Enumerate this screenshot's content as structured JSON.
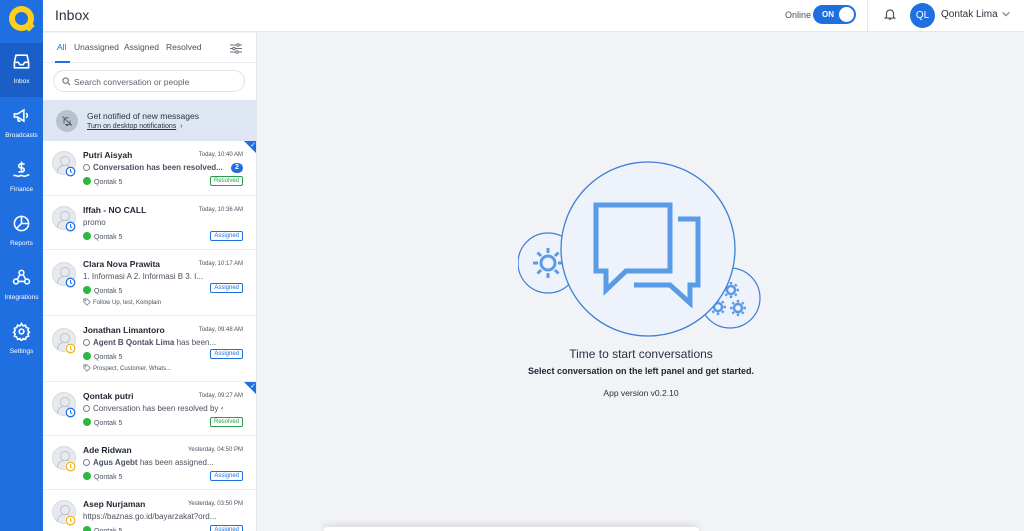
{
  "app": {
    "title": "Inbox"
  },
  "sidebar": {
    "items": [
      {
        "label": "Inbox",
        "icon": "inbox-icon",
        "active": true
      },
      {
        "label": "Broadcasts",
        "icon": "megaphone-icon"
      },
      {
        "label": "Finance",
        "icon": "dollar-icon"
      },
      {
        "label": "Reports",
        "icon": "pie-chart-icon"
      },
      {
        "label": "Integrations",
        "icon": "integrations-icon"
      },
      {
        "label": "Settings",
        "icon": "gear-icon"
      }
    ]
  },
  "topbar": {
    "status_label": "Online",
    "toggle_label": "ON",
    "user_initials": "QL",
    "user_name": "Qontak Lima"
  },
  "tabs": [
    "All",
    "Unassigned",
    "Assigned",
    "Resolved"
  ],
  "search": {
    "placeholder": "Search conversation or people"
  },
  "notification": {
    "title": "Get notified of new messages",
    "link": "Turn on desktop notifications"
  },
  "conversations": [
    {
      "name": "Putri Aisyah",
      "time": "Today, 10:40 AM",
      "preview": "Conversation has been resolved...",
      "preview_bold": true,
      "channel": "Qontak 5",
      "status": "Resolved",
      "unread": "2",
      "selected": true,
      "clock_color": "#1f6fe0"
    },
    {
      "name": "Iffah - NO CALL",
      "time": "Today, 10:36 AM",
      "preview": "promo",
      "channel": "Qontak 5",
      "status": "Assigned",
      "clock_color": "#1f6fe0"
    },
    {
      "name": "Clara Nova Prawita",
      "time": "Today, 10:17 AM",
      "preview": "1. Informasi A 2. Informasi B 3. I...",
      "channel": "Qontak 5",
      "tags": "Follow Up, test, Komplain",
      "status": "Assigned",
      "clock_color": "#1f6fe0"
    },
    {
      "name": "Jonathan Limantoro",
      "time": "Today, 09:48 AM",
      "preview_strong": "Agent B Qontak Lima",
      "preview": " has been...",
      "channel": "Qontak 5",
      "tags": "Prospect, Customer, Whats...",
      "status": "Assigned",
      "clock_color": "#f0b429"
    },
    {
      "name": "Qontak putri",
      "time": "Today, 09:27 AM",
      "preview": "Conversation has been resolved by <...",
      "channel": "Qontak 5",
      "status": "Resolved",
      "selected": true,
      "clock_color": "#1f6fe0"
    },
    {
      "name": "Ade Ridwan",
      "time": "Yesterday, 04:50 PM",
      "preview_strong": "Agus Agebt",
      "preview": " has been assigned...",
      "channel": "Qontak 5",
      "status": "Assigned",
      "clock_color": "#f0b429"
    },
    {
      "name": "Asep Nurjaman",
      "time": "Yesterday, 03:50 PM",
      "preview": "https://baznas.go.id/bayarzakat?ord...",
      "channel": "Qontak 5",
      "status": "Assigned",
      "clock_color": "#f0b429"
    }
  ],
  "empty_state": {
    "title": "Time to start conversations",
    "subtitle": "Select conversation on the left panel and get started.",
    "app_version": "App version v0.2.10"
  },
  "colors": {
    "brand": "#1f6fe0",
    "logo": "#ffcf1a",
    "resolved": "#2a9d4a",
    "whatsapp": "#2bb741"
  }
}
